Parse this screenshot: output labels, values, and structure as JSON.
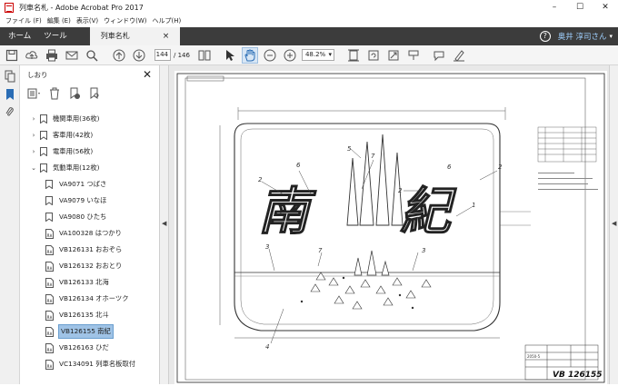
{
  "window": {
    "title": "列車名札 - Adobe Acrobat Pro 2017",
    "minimize": "–",
    "maximize": "☐",
    "close": "✕"
  },
  "menu": [
    "ファイル (F)",
    "編集 (E)",
    "表示(V)",
    "ウィンドウ(W)",
    "ヘルプ(H)"
  ],
  "tabs": {
    "home": "ホーム",
    "tools": "ツール",
    "document": "列車名札",
    "close": "×",
    "help": "?",
    "user": "奥井 淳司さん",
    "user_caret": "▾"
  },
  "toolbar": {
    "current_page": "144",
    "total_pages": "/ 146",
    "zoom": "48.2%"
  },
  "sidebar": {
    "title": "しおり",
    "close": "✕",
    "items": [
      {
        "label": "機関車用(36枚)",
        "expanded": false
      },
      {
        "label": "客車用(42枚)",
        "expanded": false
      },
      {
        "label": "電車用(56枚)",
        "expanded": false
      },
      {
        "label": "気動車用(12枚)",
        "expanded": true
      }
    ],
    "children": [
      "VA9071 つばさ",
      "VA9079 いなほ",
      "VA9080 ひたち",
      "VA100328 はつかり",
      "VB126131 おおぞら",
      "VB126132 おおとり",
      "VB126133 北海",
      "VB126134 オホーツク",
      "VB126135 北斗",
      "VB126155 南紀",
      "VB126163 ひだ",
      "VC134091 列車名板取付"
    ],
    "selected_child": "VB126155 南紀"
  },
  "drawing": {
    "name_text": "南紀",
    "drawing_number": "VB 126155",
    "stamp": "2050-5",
    "leaders": [
      "1",
      "2",
      "3",
      "4",
      "5",
      "6",
      "7"
    ]
  }
}
